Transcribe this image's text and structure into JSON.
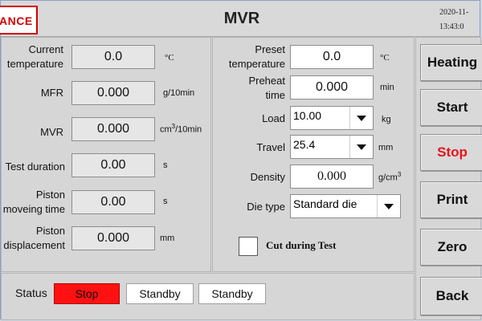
{
  "header": {
    "logo_text": "ANCE",
    "title": "MVR",
    "date": "2020-11-",
    "time": "13:43:0"
  },
  "left": {
    "current_temperature": {
      "label_line1": "Current",
      "label_line2": "temperature",
      "value": "0.0",
      "unit": "°C"
    },
    "mfr": {
      "label": "MFR",
      "value": "0.000",
      "unit": "g/10min"
    },
    "mvr": {
      "label": "MVR",
      "value": "0.000",
      "unit_base": "cm",
      "unit_sup": "3",
      "unit_tail": "/10min"
    },
    "test_duration": {
      "label": "Test duration",
      "value": "0.00",
      "unit": "s"
    },
    "piston_moving_time": {
      "label_line1": "Piston",
      "label_line2": "moveing time",
      "value": "0.00",
      "unit": "s"
    },
    "piston_displacement": {
      "label_line1": "Piston",
      "label_line2": "displacement",
      "value": "0.000",
      "unit": "mm"
    }
  },
  "middle": {
    "preset_temperature": {
      "label_line1": "Preset",
      "label_line2": "temperature",
      "value": "0.0",
      "unit": "°C"
    },
    "preheat_time": {
      "label_line1": "Preheat",
      "label_line2": "time",
      "value": "0.000",
      "unit": "min"
    },
    "load": {
      "label": "Load",
      "value": "10.00",
      "unit": "kg"
    },
    "travel": {
      "label": "Travel",
      "value": "25.4",
      "unit": "mm"
    },
    "density": {
      "label": "Density",
      "value": "0.000",
      "unit_base": "g/cm",
      "unit_sup": "3"
    },
    "die_type": {
      "label": "Die type",
      "value": "Standard die"
    },
    "cut_during_test": {
      "label": "Cut during Test",
      "checked": false
    }
  },
  "buttons": {
    "heating": "Heating",
    "start": "Start",
    "stop": "Stop",
    "print": "Print",
    "zero": "Zero",
    "back": "Back"
  },
  "status": {
    "label": "Status",
    "value1": "Stop",
    "value2": "Standby",
    "value3": "Standby"
  },
  "colors": {
    "status_stop_bg": "#ff1111",
    "stop_text": "#e8121e",
    "logo_red": "#d40000"
  }
}
